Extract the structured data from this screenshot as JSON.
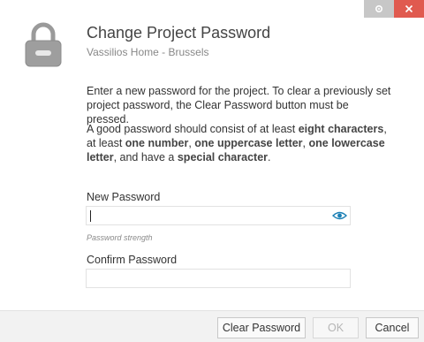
{
  "window": {
    "title": "Change Project Password",
    "subtitle": "Vassilios Home - Brussels"
  },
  "intro_text": "Enter a new password for the project. To clear a previously set project password, the Clear Password button must be pressed.",
  "requirements": {
    "prefix": "A good password should consist of at least ",
    "eight_chars": "eight characters",
    "sep1": ", at least ",
    "one_number": "one number",
    "sep2": ", ",
    "one_uppercase": "one uppercase letter",
    "sep3": ", ",
    "one_lowercase": "one lowercase letter",
    "sep4": ", and have a ",
    "special_char": "special character",
    "suffix": "."
  },
  "new_password": {
    "label": "New Password",
    "value": "",
    "strength_label": "Password strength"
  },
  "confirm_password": {
    "label": "Confirm Password",
    "value": ""
  },
  "buttons": {
    "clear": "Clear Password",
    "ok": "OK",
    "cancel": "Cancel"
  },
  "icons": {
    "settings": "gear-icon",
    "close": "close-icon",
    "lock": "lock-icon",
    "reveal": "eye-icon"
  },
  "colors": {
    "close_button": "#e05a4f",
    "settings_button": "#c7c7c7",
    "eye_icon": "#1a7fb5"
  }
}
